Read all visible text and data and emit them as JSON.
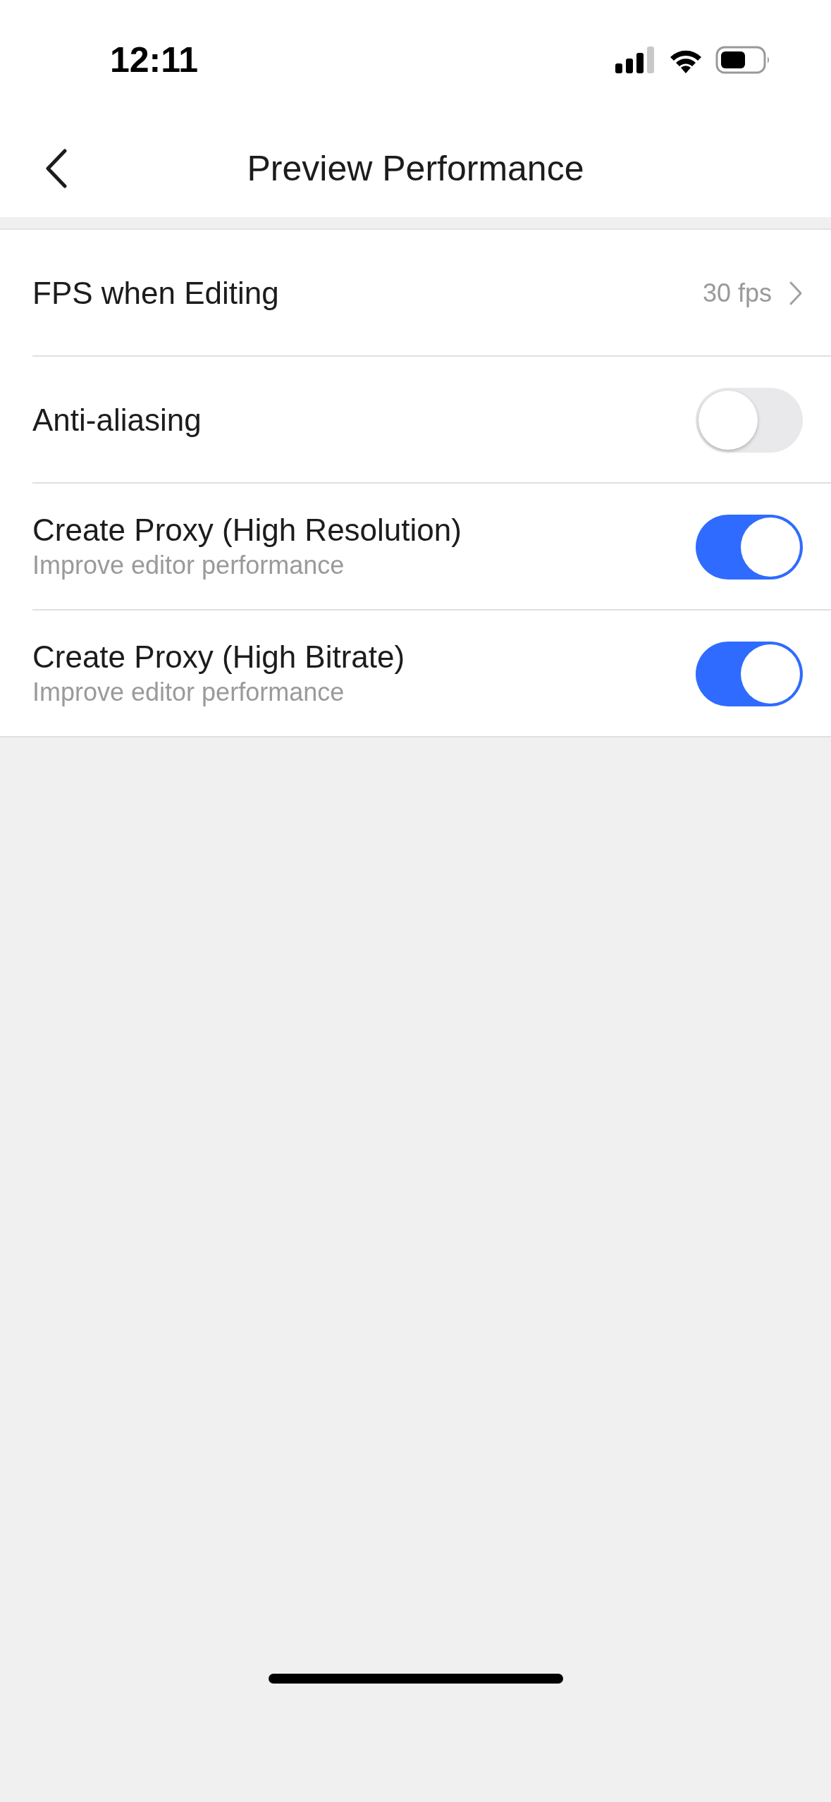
{
  "status_bar": {
    "time": "12:11"
  },
  "nav": {
    "title": "Preview Performance"
  },
  "settings": [
    {
      "kind": "link",
      "label": "FPS when Editing",
      "value": "30 fps"
    },
    {
      "kind": "toggle",
      "label": "Anti-aliasing",
      "on": false
    },
    {
      "kind": "toggle",
      "label": "Create Proxy (High Resolution)",
      "subtitle": "Improve editor performance",
      "on": true
    },
    {
      "kind": "toggle",
      "label": "Create Proxy (High Bitrate)",
      "subtitle": "Improve editor performance",
      "on": true
    }
  ]
}
